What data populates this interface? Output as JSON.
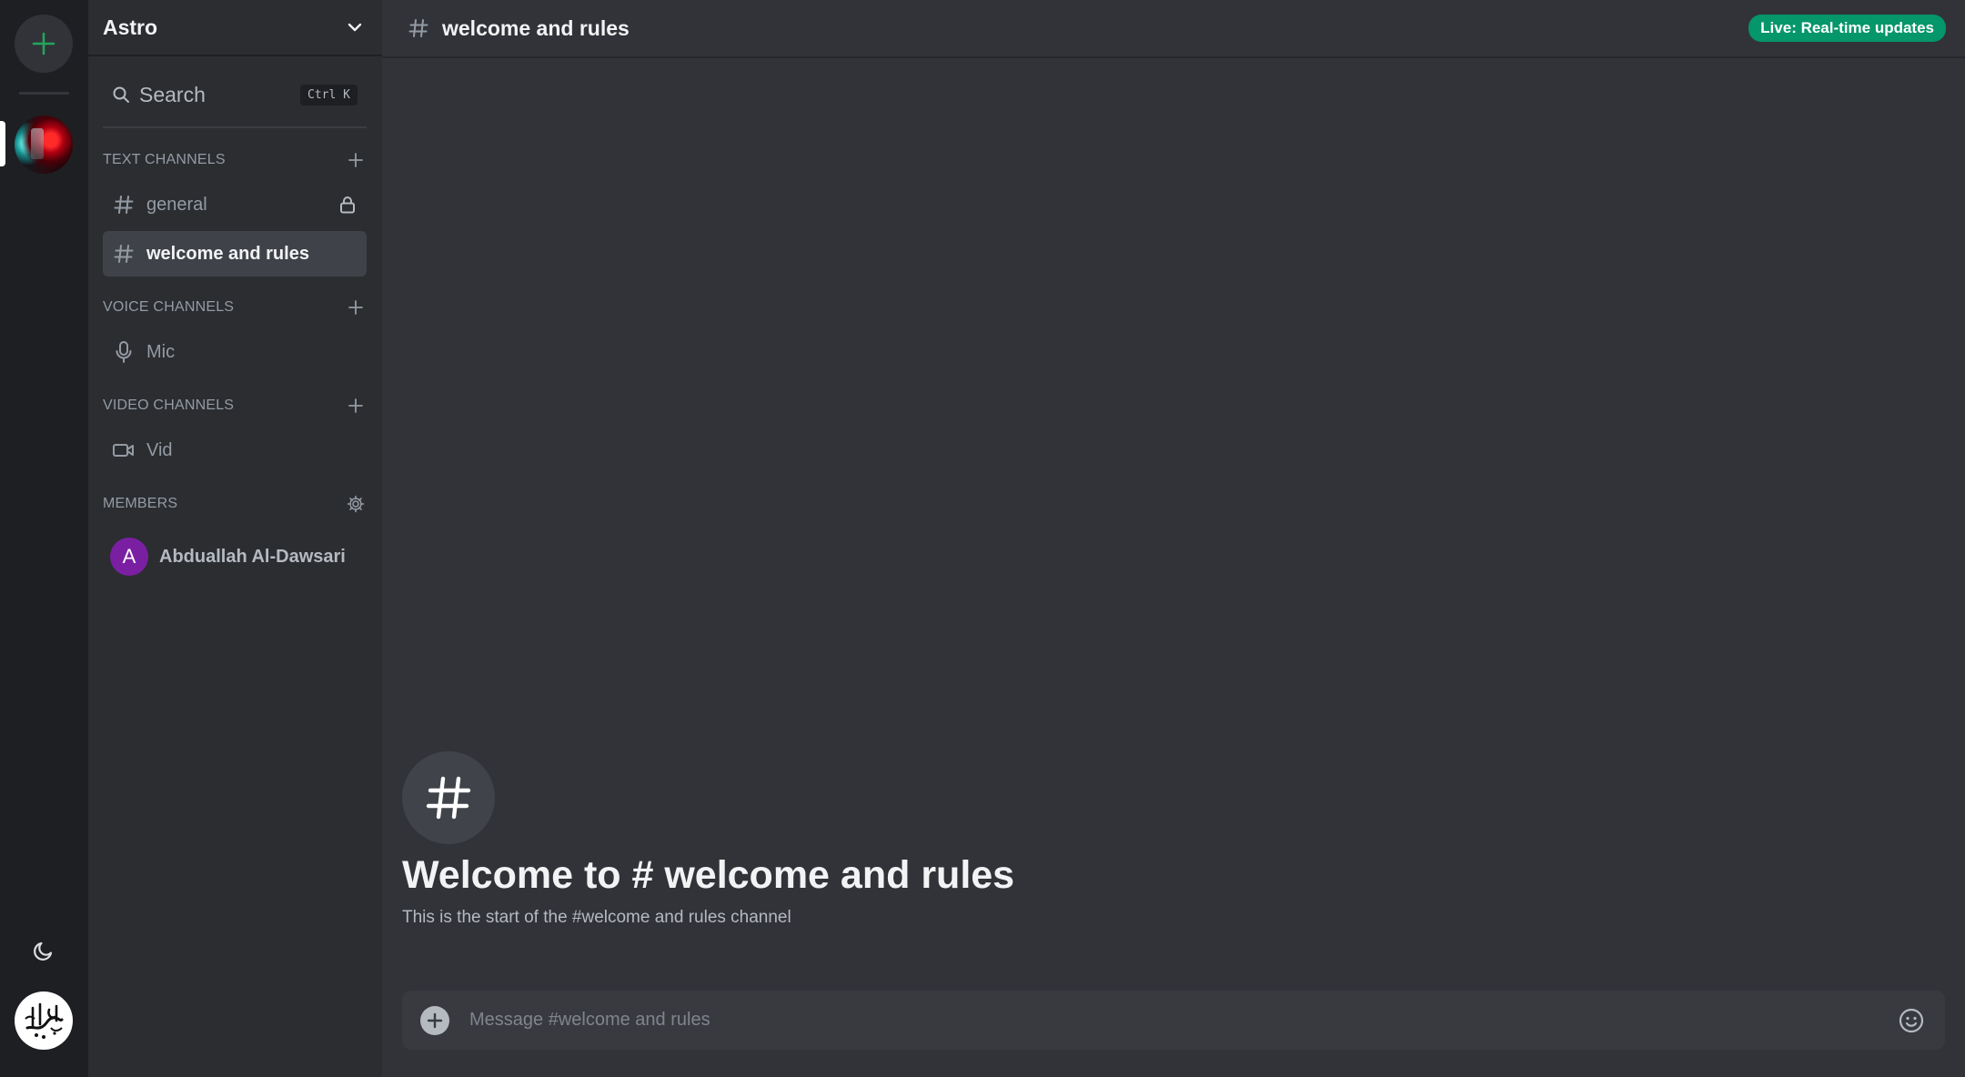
{
  "server": {
    "name": "Astro"
  },
  "search": {
    "label": "Search",
    "shortcut": "Ctrl K"
  },
  "sections": {
    "text": {
      "title": "TEXT CHANNELS"
    },
    "voice": {
      "title": "VOICE CHANNELS"
    },
    "video": {
      "title": "VIDEO CHANNELS"
    },
    "members": {
      "title": "MEMBERS"
    }
  },
  "channels": {
    "text": [
      {
        "label": "general",
        "locked": true,
        "active": false
      },
      {
        "label": "welcome and rules",
        "locked": false,
        "active": true
      }
    ],
    "voice": [
      {
        "label": "Mic"
      }
    ],
    "video": [
      {
        "label": "Vid"
      }
    ]
  },
  "members": [
    {
      "initial": "A",
      "name": "Abduallah Al-Dawsari",
      "avatar_color": "#7b1fa2"
    }
  ],
  "topbar": {
    "channel_name": "welcome and rules",
    "live_badge": "Live: Real-time updates"
  },
  "welcome": {
    "title": "Welcome to # welcome and rules",
    "subtitle": "This is the start of the #welcome and rules channel"
  },
  "composer": {
    "placeholder": "Message #welcome and rules"
  },
  "icons": {
    "add_server": "plus-icon",
    "theme": "moon-icon",
    "search": "search-icon",
    "text_channel": "hash-icon",
    "voice_channel": "microphone-icon",
    "video_channel": "video-camera-icon",
    "lock": "lock-icon",
    "settings": "gear-icon",
    "emoji": "smiley-icon"
  },
  "colors": {
    "accent_green": "#23a55a",
    "live_badge": "#059669",
    "rail_bg": "#1e1f22",
    "sidebar_bg": "#2b2d31",
    "main_bg": "#313338"
  }
}
